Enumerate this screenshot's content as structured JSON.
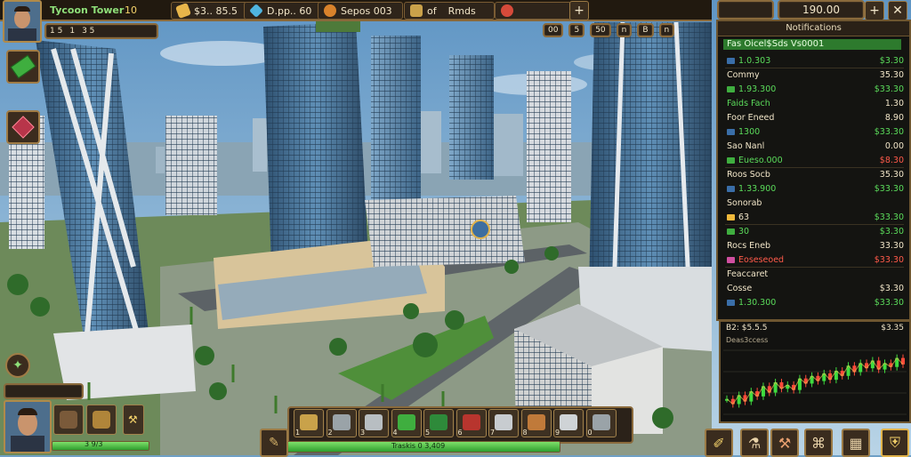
{
  "player": {
    "name": "Tycoon Tower",
    "level": "10"
  },
  "top_resources": [
    {
      "icon": "cash-icon",
      "value": "$3.. 85.5"
    },
    {
      "icon": "diamond-icon",
      "value": "D.pp.. 60"
    },
    {
      "icon": "coins-icon",
      "value": "Sepos 003"
    },
    {
      "icon": "checkmark-icon",
      "value": "Rmds"
    }
  ],
  "top_resource_prefix": {
    "checkmark": "of"
  },
  "top_right": {
    "money": "190.00"
  },
  "mini_status": {
    "a": "1 5",
    "b": "1",
    "c": "3 5"
  },
  "view_controls": [
    "00",
    "5",
    "50",
    "n",
    "B",
    "n"
  ],
  "stats_panel": {
    "header": "Notifications",
    "headline": "Fas Oicel$Sds Vs0001",
    "rows": [
      {
        "label": "1.0.303",
        "value": "$3.30",
        "label_color": "green",
        "value_color": "green",
        "swatch": "#3a6ea8"
      },
      {
        "label": "Commy",
        "value": "35.30",
        "label_color": "white",
        "value_color": "white",
        "swatch": ""
      },
      {
        "label": "1.93.300",
        "value": "$33.30",
        "label_color": "green",
        "value_color": "green",
        "swatch": "#3fae3f"
      },
      {
        "label": "Faids Fach",
        "value": "1.30",
        "label_color": "green",
        "value_color": "white",
        "swatch": ""
      },
      {
        "label": "Foor Eneed",
        "value": "8.90",
        "label_color": "white",
        "value_color": "white",
        "swatch": ""
      },
      {
        "label": "1300",
        "value": "$33.30",
        "label_color": "green",
        "value_color": "green",
        "swatch": "#3a6ea8"
      },
      {
        "label": "Sao Nanl",
        "value": "0.00",
        "label_color": "white",
        "value_color": "white",
        "swatch": ""
      },
      {
        "label": "Eueso.000",
        "value": "$8.30",
        "label_color": "green",
        "value_color": "red",
        "swatch": "#3fae3f"
      },
      {
        "label": "Roos Socb",
        "value": "35.30",
        "label_color": "white",
        "value_color": "white",
        "swatch": ""
      },
      {
        "label": "1.33.900",
        "value": "$33.30",
        "label_color": "green",
        "value_color": "green",
        "swatch": "#3a6ea8"
      },
      {
        "label": "Sonorab",
        "value": "",
        "label_color": "white",
        "value_color": "white",
        "swatch": ""
      },
      {
        "label": "63",
        "value": "$33.30",
        "label_color": "white",
        "value_color": "green",
        "swatch": "#f0b93a"
      },
      {
        "label": "30",
        "value": "$3.30",
        "label_color": "green",
        "value_color": "green",
        "swatch": "#3fae3f"
      },
      {
        "label": "Rocs Eneb",
        "value": "33.30",
        "label_color": "white",
        "value_color": "white",
        "swatch": ""
      },
      {
        "label": "Eoseseoed",
        "value": "$33.30",
        "label_color": "red",
        "value_color": "red",
        "swatch": "#d04fa0"
      },
      {
        "label": "Feaccaret",
        "value": "",
        "label_color": "white",
        "value_color": "white",
        "swatch": ""
      },
      {
        "label": "Cosse",
        "value": "$3.30",
        "label_color": "white",
        "value_color": "white",
        "swatch": ""
      },
      {
        "label": "1.30.300",
        "value": "$33.30",
        "label_color": "green",
        "value_color": "green",
        "swatch": "#3a6ea8"
      }
    ]
  },
  "market_chart": {
    "title": "B2: $5.5.5",
    "subtitle": "Deas3ccess",
    "right_label": "$3.35"
  },
  "chart_data": {
    "type": "line",
    "title": "",
    "x": [
      1,
      2,
      3,
      4,
      5,
      6,
      7,
      8,
      9,
      10,
      11,
      12,
      13,
      14,
      15,
      16,
      17,
      18,
      19,
      20,
      21,
      22,
      23,
      24,
      25,
      26,
      27,
      28,
      29,
      30
    ],
    "series": [
      {
        "values": [
          42,
          38,
          45,
          40,
          48,
          44,
          52,
          47,
          55,
          50,
          53,
          49,
          58,
          54,
          60,
          56,
          62,
          57,
          64,
          60,
          68,
          63,
          70,
          66,
          72,
          65,
          70,
          67,
          74,
          69
        ]
      }
    ],
    "ylim": [
      30,
      80
    ],
    "grid": true
  },
  "toolbar": {
    "slots": [
      "1",
      "2",
      "3",
      "4",
      "5",
      "6",
      "7",
      "8",
      "9",
      "0"
    ],
    "bottom_label": "Traskis 0 3,409"
  },
  "player_bar": {
    "label": "3 9/3"
  },
  "colors": {
    "frame": "#8a6a3c",
    "panel": "#2b2219",
    "green": "#5bdc5b",
    "red": "#ff5a4a",
    "gold": "#f5d36b"
  }
}
